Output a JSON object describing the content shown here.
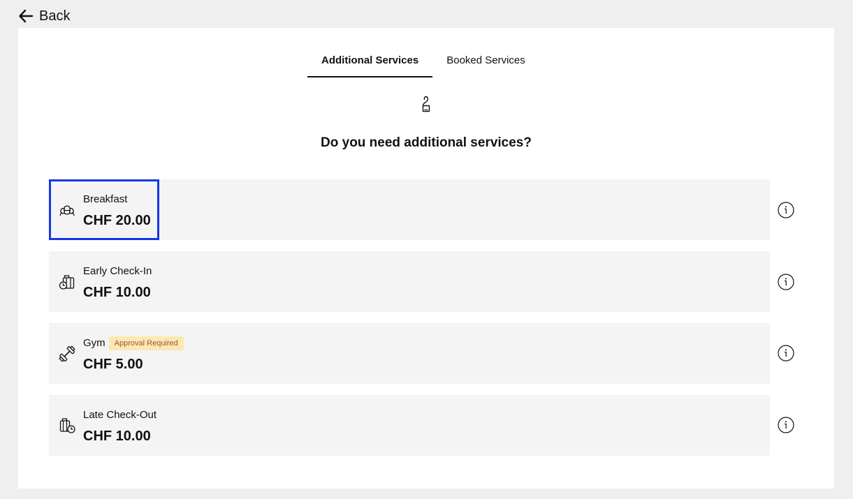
{
  "header": {
    "back_label": "Back"
  },
  "tabs": [
    {
      "label": "Additional Services",
      "active": true
    },
    {
      "label": "Booked Services",
      "active": false
    }
  ],
  "question": "Do you need additional services?",
  "services": [
    {
      "name": "Breakfast",
      "price": "CHF 20.00",
      "icon": "croissant-icon",
      "badge": ""
    },
    {
      "name": "Early Check-In",
      "price": "CHF 10.00",
      "icon": "luggage-clock-icon",
      "badge": ""
    },
    {
      "name": "Gym",
      "price": "CHF 5.00",
      "icon": "dumbbell-icon",
      "badge": "Approval Required"
    },
    {
      "name": "Late Check-Out",
      "price": "CHF 10.00",
      "icon": "suitcase-clock-icon",
      "badge": ""
    }
  ],
  "colors": {
    "page_background": "#efefef",
    "card_background": "#ffffff",
    "row_background": "#f4f4f4",
    "focus_outline": "#1536e6",
    "badge_background": "#fbe8b4",
    "badge_text": "#a0522d"
  }
}
